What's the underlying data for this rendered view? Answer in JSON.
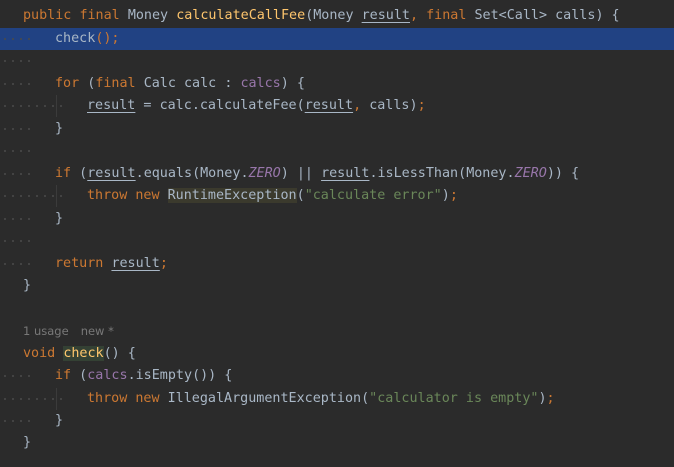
{
  "editor": {
    "language": "Java",
    "current_line_color": "#214283",
    "code": {
      "method1": {
        "modifier_public": "public",
        "modifier_final": "final",
        "return_type": "Money",
        "name": "calculateCallFee",
        "param1_type": "Money",
        "param1_name": "result",
        "param2_final": "final",
        "param2_type": "Set<Call>",
        "param2_name": "calls",
        "check_call": "check",
        "for_kw": "for",
        "for_final": "final",
        "for_type": "Calc",
        "for_var": "calc",
        "for_colon": ":",
        "for_iter": "calcs",
        "assign_target": "result",
        "assign_obj": "calc",
        "assign_method": "calculateFee",
        "assign_arg1": "result",
        "assign_arg2": "calls",
        "if_kw": "if",
        "cond1_obj": "result",
        "cond1_method": "equals",
        "money_cls1": "Money",
        "zero1": "ZERO",
        "or_op": "||",
        "cond2_obj": "result",
        "cond2_method": "isLessThan",
        "money_cls2": "Money",
        "zero2": "ZERO",
        "throw_kw": "throw",
        "new_kw": "new",
        "exception1": "RuntimeException",
        "message1": "\"calculate error\"",
        "return_kw": "return",
        "return_val": "result"
      },
      "hints": {
        "usages": "1 usage",
        "status": "new *"
      },
      "method2": {
        "return_type": "void",
        "name": "check",
        "if_kw": "if",
        "field": "calcs",
        "method": "isEmpty",
        "throw_kw": "throw",
        "new_kw": "new",
        "exception2": "IllegalArgumentException",
        "message2": "\"calculator is empty\""
      }
    }
  }
}
